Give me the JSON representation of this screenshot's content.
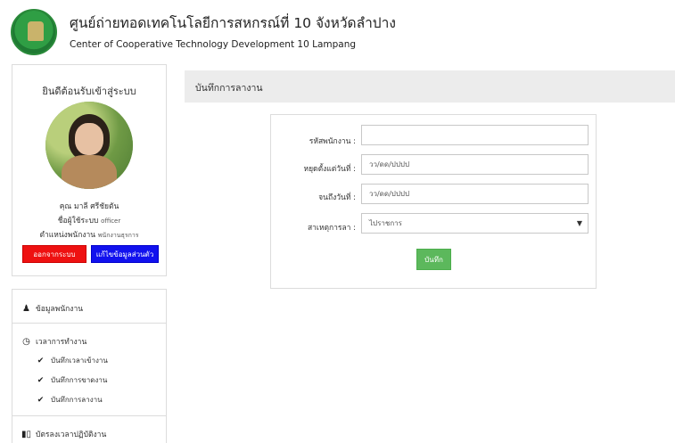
{
  "header": {
    "title": "ศูนย์ถ่ายทอดเทคโนโลยีการสหกรณ์ที่ 10 จังหวัดลำปาง",
    "subtitle": "Center of Cooperative Technology Development 10 Lampang"
  },
  "profile": {
    "welcome": "ยินดีต้อนรับเข้าสู่ระบบ",
    "name": "คุณ มาลี ศรีชัยตัน",
    "username_label": "ชื่อผู้ใช้ระบบ",
    "username": "officer",
    "position_label": "ตำแหน่งพนักงาน",
    "position": "พนักงานธุรการ",
    "logout_label": "ออกจากระบบ",
    "edit_label": "แก้ไขข้อมูลส่วนตัว"
  },
  "menu": {
    "employee_data": "ข้อมูลพนักงาน",
    "work_time": "เวลาการทำงาน",
    "sub_items": [
      "บันทึกเวลาเข้างาน",
      "บันทึกการขาดงาน",
      "บันทึกการลางาน"
    ],
    "time_card": "บัตรลงเวลาปฏิบัติงาน"
  },
  "page": {
    "title": "บันทึกการลางาน"
  },
  "form": {
    "employee_id_label": "รหัสพนักงาน :",
    "employee_id_value": "",
    "from_date_label": "หยุดตั้งแต่วันที่ :",
    "from_date_placeholder": "วว/ดด/ปปปป",
    "to_date_label": "จนถึงวันที่ :",
    "to_date_placeholder": "วว/ดด/ปปปป",
    "reason_label": "สาเหตุการลา :",
    "reason_selected": "ไปราชการ",
    "save_label": "บันทึก"
  },
  "colors": {
    "logout_button": "#ee1111",
    "edit_button": "#1111ee",
    "save_button": "#5cb85c",
    "page_header_bg": "#ececec"
  }
}
